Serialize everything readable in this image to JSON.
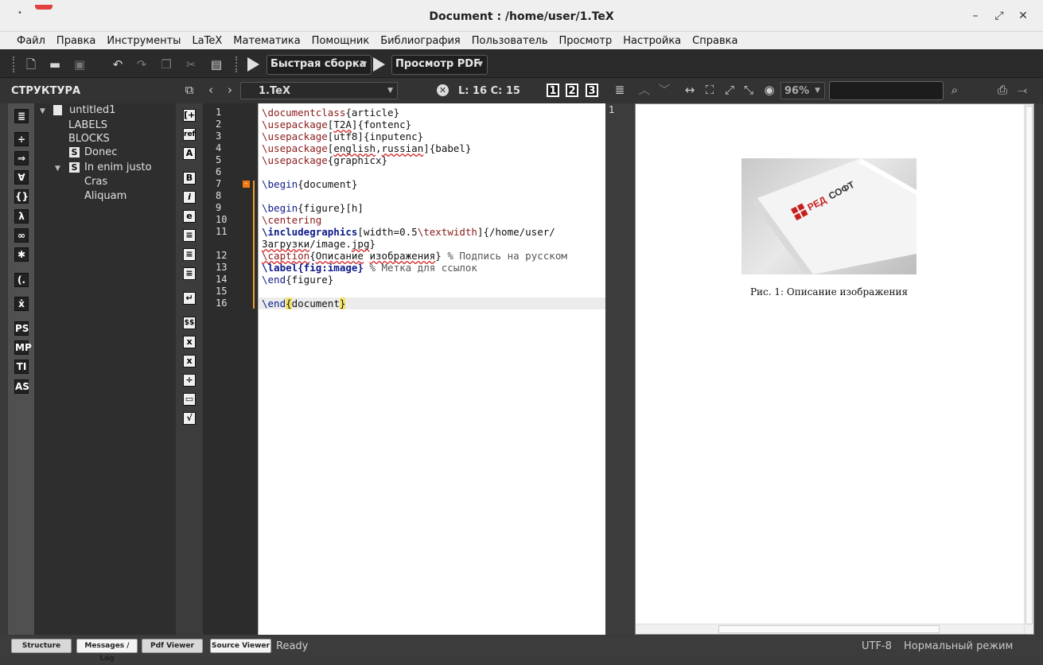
{
  "window": {
    "title": "Document : /home/user/1.TeX",
    "buttons": {
      "minimize": "–",
      "restore": "⤢",
      "close": "✕"
    }
  },
  "menu": [
    "Файл",
    "Правка",
    "Инструменты",
    "LaTeX",
    "Математика",
    "Помощник",
    "Библиография",
    "Пользователь",
    "Просмотр",
    "Настройка",
    "Справка"
  ],
  "toolbar": {
    "build_label": "Быстрая сборка",
    "view_label": "Просмотр PDF"
  },
  "structure": {
    "title": "СТРУКТУРА",
    "tree": [
      {
        "label": "untitled1"
      },
      {
        "label": "LABELS"
      },
      {
        "label": "BLOCKS"
      },
      {
        "label": "Donec",
        "badge": "S"
      },
      {
        "label": "In enim justo",
        "badge": "S"
      },
      {
        "label": "Cras"
      },
      {
        "label": "Aliquam"
      }
    ]
  },
  "editor_header": {
    "file": "1.TeX",
    "cursor": "L: 16 C: 15",
    "bookmarks": [
      "1",
      "2",
      "3"
    ]
  },
  "left_icons": [
    "≣",
    "÷",
    "⇒",
    "∀",
    "{}",
    "λ",
    "∞",
    "✱",
    "(.",
    "ẋ",
    "PS",
    "MP",
    "TI",
    "AS"
  ],
  "math_icons": [
    "[+",
    "ref",
    "A",
    "B",
    "i",
    "e",
    "≡",
    "≡",
    "≡",
    "↵",
    "$$",
    "x",
    "x",
    "÷",
    "▭",
    "√"
  ],
  "line_numbers": [
    "1",
    "2",
    "3",
    "4",
    "5",
    "6",
    "7",
    "8",
    "9",
    "10",
    "11",
    "",
    "12",
    "13",
    "14",
    "15",
    "16"
  ],
  "code": {
    "l1_cmd": "\\documentclass",
    "l1_arg": "{article}",
    "l2_cmd": "\\usepackage",
    "l2_opt": "T2A",
    "l2_arg": "{fontenc}",
    "l3_cmd": "\\usepackage",
    "l3_arg": "[utf8]{inputenc}",
    "l4_cmd": "\\usepackage",
    "l4_opt1": "english",
    "l4_opt2": "russian",
    "l4_arg": "{babel}",
    "l5_cmd": "\\usepackage",
    "l5_arg": "{graphicx}",
    "l7_cmd": "\\begin",
    "l7_arg": "{document}",
    "l9_cmd": "\\begin",
    "l9_arg": "{figure}[h]",
    "l10_cmd": "\\centering",
    "l11_cmd": "\\includegraphics",
    "l11_opt": "[width=0.5",
    "l11_cmd2": "\\textwidth",
    "l11_arg": "]{/home/user/",
    "l11b_path1": "Загрузки",
    "l11b_path2": "/image.",
    "l11b_path3": "jpg",
    "l11b_end": "}",
    "l12_cmd": "\\caption",
    "l12_arg_open": "{",
    "l12_w1": "Описание",
    "l12_w2": "изображения",
    "l12_arg_close": "}",
    "l12_comment": " % Подпись на русском",
    "l13_cmd": "\\label{fig:image}",
    "l13_comment": " % Метка для ссылок",
    "l14_cmd": "\\end",
    "l14_arg": "{figure}",
    "l16_cmd": "\\end",
    "l16_b1": "{",
    "l16_arg": "document",
    "l16_b2": "}"
  },
  "pdf": {
    "page_number": "1",
    "zoom": "96%",
    "logo_text_red": "РЕД",
    "logo_text_dark": "СОФТ",
    "caption": "Рис. 1: Описание изображения"
  },
  "status": {
    "tabs": [
      "Structure",
      "Messages / Log",
      "Pdf Viewer",
      "Source Viewer"
    ],
    "ready": "Ready",
    "encoding": "UTF-8",
    "mode": "Нормальный режим"
  }
}
